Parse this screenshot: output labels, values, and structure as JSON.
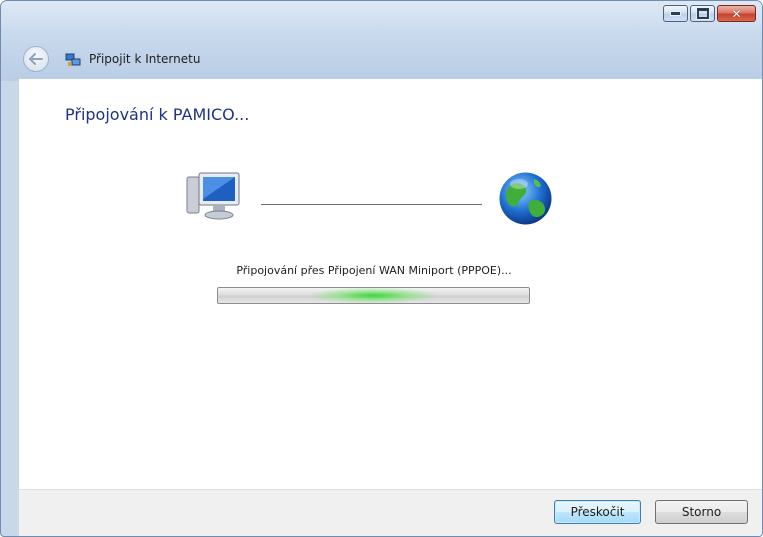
{
  "window": {
    "title": "Připojit k Internetu",
    "caption_buttons": [
      "minimize",
      "maximize",
      "close"
    ]
  },
  "main": {
    "heading": "Připojování k PAMICO...",
    "status_text": "Připojování přes Připojení WAN Miniport (PPPOE)...",
    "progress": {
      "style": "marquee",
      "color": "#36d636"
    },
    "icons": [
      "computer-icon",
      "globe-icon"
    ]
  },
  "footer": {
    "skip_label": "Přeskočit",
    "cancel_label": "Storno"
  },
  "colors": {
    "heading": "#1e3287",
    "accent": "#3c7fb1"
  }
}
